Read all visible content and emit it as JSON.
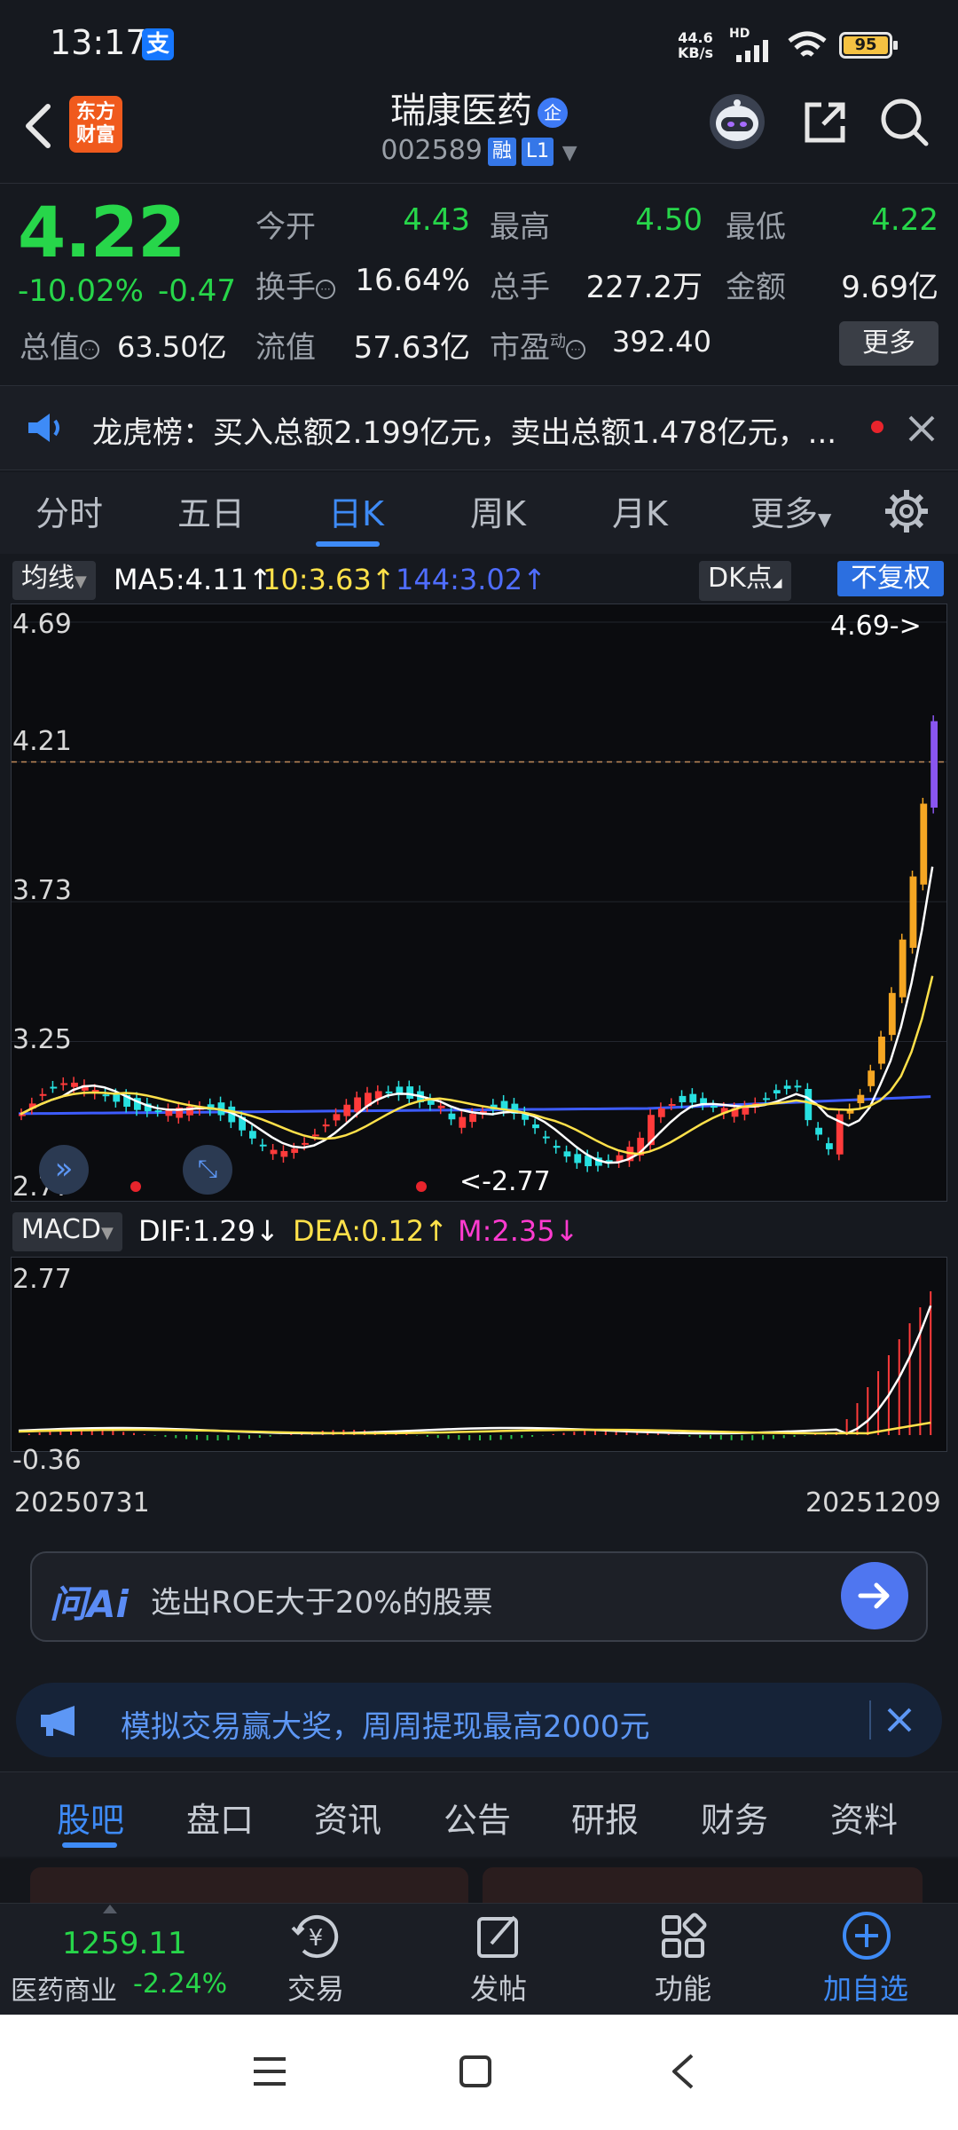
{
  "status": {
    "time": "13:17",
    "alipay": "支",
    "net_speed": "44.6",
    "net_unit": "KB/s",
    "hd": "HD",
    "battery": "95"
  },
  "header": {
    "logo_line1": "东方",
    "logo_line2": "财富",
    "stock_name": "瑞康医药",
    "qi_badge": "企",
    "stock_code": "002589",
    "tag_rong": "融",
    "tag_level": "L1"
  },
  "quote": {
    "price": "4.22",
    "change_pct": "-10.02%",
    "change_abs": "-0.47",
    "open_label": "今开",
    "open_value": "4.43",
    "high_label": "最高",
    "high_value": "4.50",
    "low_label": "最低",
    "low_value": "4.22",
    "turnover_label": "换手",
    "turnover_value": "16.64%",
    "volume_label": "总手",
    "volume_value": "227.2万",
    "amount_label": "金额",
    "amount_value": "9.69亿",
    "mktcap_label": "总值",
    "mktcap_value": "63.50亿",
    "float_label": "流值",
    "float_value": "57.63亿",
    "pe_label": "市盈",
    "pe_sup": "动",
    "pe_value": "392.40",
    "more_button": "更多"
  },
  "notice": {
    "text": "龙虎榜：买入总额2.199亿元，卖出总额1.478亿元，..."
  },
  "period_tabs": [
    {
      "label": "分时"
    },
    {
      "label": "五日"
    },
    {
      "label": "日K"
    },
    {
      "label": "周K"
    },
    {
      "label": "月K"
    },
    {
      "label": "更多"
    }
  ],
  "ma_row": {
    "indicator": "均线",
    "ma5": "MA5:4.11",
    "ma10": "10:3.63",
    "ma144": "144:3.02",
    "dk": "DK点",
    "fq": "不复权"
  },
  "kchart": {
    "y_labels": [
      "4.69",
      "4.21",
      "3.73",
      "3.25",
      "2.77"
    ],
    "high_marker": "4.69->",
    "low_marker": "<-2.77"
  },
  "macd_row": {
    "indicator": "MACD",
    "dif": "DIF:1.29",
    "dea": "DEA:0.12",
    "m": "M:2.35"
  },
  "macd_chart": {
    "y_top": "2.77",
    "y_bottom": "-0.36",
    "date_start": "20250731",
    "date_end": "20251209"
  },
  "chart_data": {
    "type": "candlestick",
    "ylim": [
      2.77,
      4.69
    ],
    "current_line": 4.21,
    "colors": {
      "up": "#ff3b3b",
      "down": "#27e0e0",
      "limit": "#f5a623",
      "ma5": "#ffffff",
      "ma10": "#ffe14a",
      "ma144": "#3d5cff",
      "dif": "#ffffff",
      "dea": "#ffe14a"
    }
  },
  "ai": {
    "logo": "问Ai",
    "query": "选出ROE大于20%的股票"
  },
  "promo": {
    "text": "模拟交易赢大奖，周周提现最高2000元"
  },
  "content_tabs": [
    {
      "label": "股吧"
    },
    {
      "label": "盘口"
    },
    {
      "label": "资讯"
    },
    {
      "label": "公告"
    },
    {
      "label": "研报"
    },
    {
      "label": "财务"
    },
    {
      "label": "资料"
    }
  ],
  "bottom_nav": {
    "index_value": "1259.11",
    "index_name": "医药商业",
    "index_change": "-2.24%",
    "trade": "交易",
    "post": "发帖",
    "function": "功能",
    "add_watch": "加自选"
  }
}
